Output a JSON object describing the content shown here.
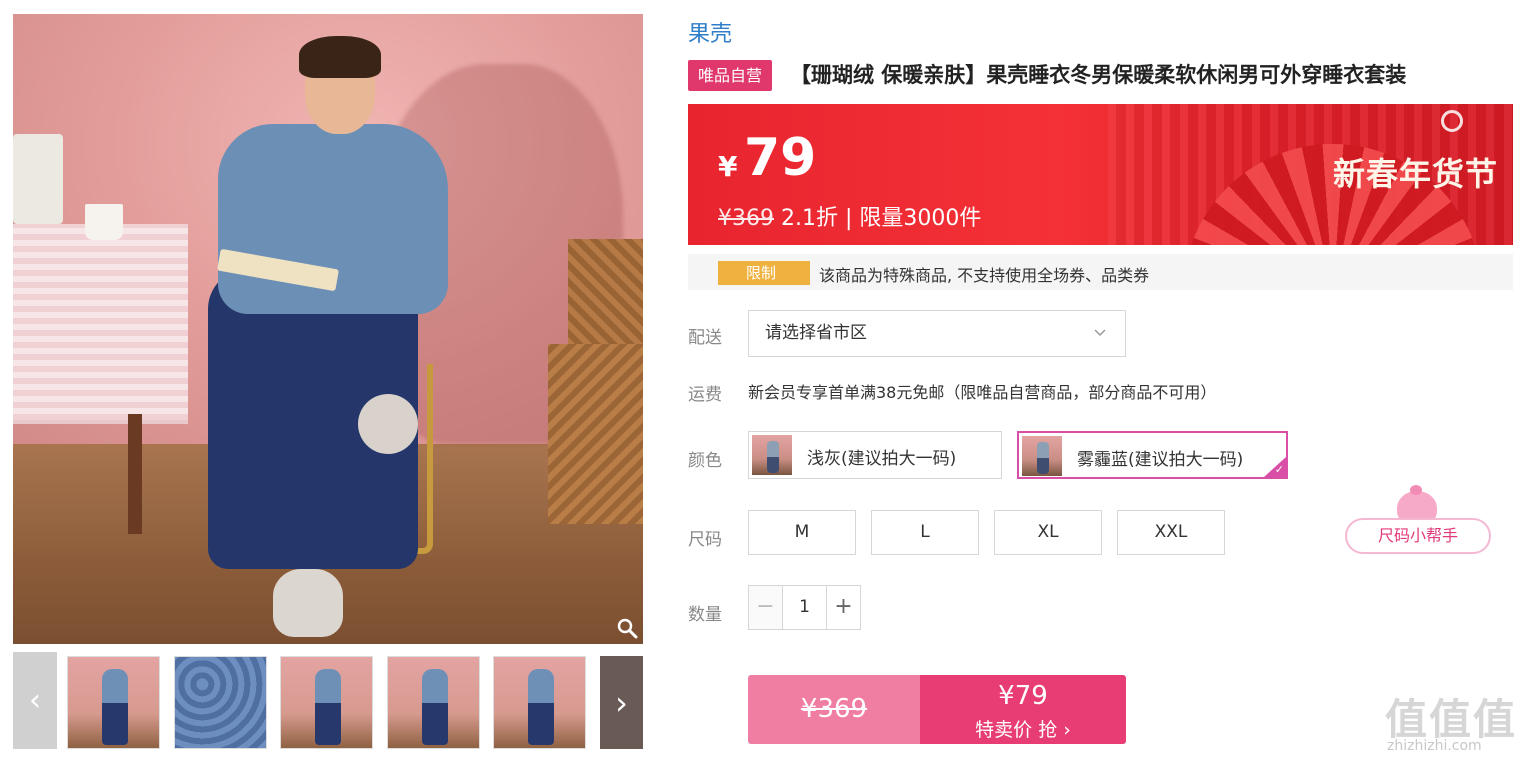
{
  "product": {
    "brand": "果壳",
    "vip_tag": "唯品自营",
    "title": "【珊瑚绒 保暖亲肤】果壳睡衣冬男保暖柔软休闲男可外穿睡衣套装"
  },
  "price": {
    "currency": "¥",
    "current": "79",
    "original": "¥369",
    "discount": "2.1折 | 限量3000件",
    "festival": "新春年货节",
    "banner_color": "#e8252f"
  },
  "restriction": {
    "badge": "限制",
    "text": "该商品为特殊商品, 不支持使用全场券、品类券",
    "badge_color": "#f0b23f"
  },
  "delivery": {
    "label": "配送",
    "placeholder": "请选择省市区",
    "chevron_icon": "chevron-down-icon"
  },
  "shipping": {
    "label": "运费",
    "text": "新会员专享首单满38元免邮（限唯品自营商品，部分商品不可用）"
  },
  "color": {
    "label": "颜色",
    "options": [
      {
        "label": "浅灰(建议拍大一码)",
        "selected": false
      },
      {
        "label": "雾霾蓝(建议拍大一码)",
        "selected": true
      }
    ],
    "selected_border": "#d94fa5"
  },
  "size": {
    "label": "尺码",
    "options": [
      "M",
      "L",
      "XL",
      "XXL"
    ],
    "helper": "尺码小帮手"
  },
  "quantity": {
    "label": "数量",
    "value": "1",
    "minus": "−",
    "plus": "+"
  },
  "buy": {
    "old_price": "¥369",
    "new_price": "¥79",
    "cta": "特卖价 抢 ›",
    "accent": "#e83d74"
  },
  "gallery": {
    "prev_icon": "‹",
    "next_icon": "›",
    "thumb_count": 6
  },
  "watermark": {
    "glyphs": "值值值",
    "url": "zhizhizhi.com"
  }
}
